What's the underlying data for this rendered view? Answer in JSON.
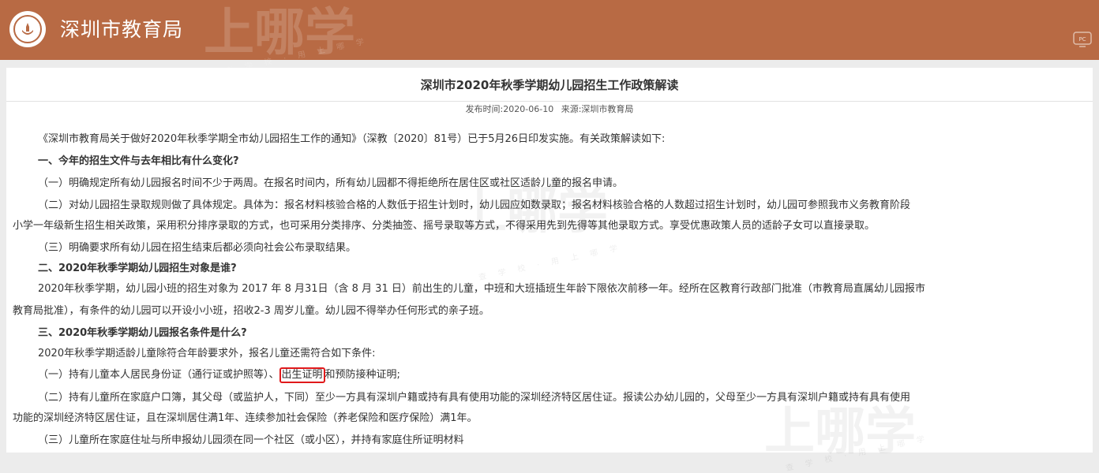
{
  "header": {
    "site_name": "深圳市教育局",
    "watermark_text": "上哪学",
    "watermark_sub": "查 学 校 · 用 上 哪 学",
    "pc_icon_label": "PC",
    "bg_color": "#b86a44"
  },
  "article": {
    "title": "深圳市2020年秋季学期幼儿园招生工作政策解读",
    "publish_time": "发布时间:2020-06-10",
    "source": "来源:深圳市教育局",
    "paragraphs": [
      "《深圳市教育局关于做好2020年秋季学期全市幼儿园招生工作的通知》（深教〔2020〕81号）已于5月26日印发实施。有关政策解读如下:",
      "一、今年的招生文件与去年相比有什么变化?",
      "（一）明确规定所有幼儿园报名时间不少于两周。在报名时间内，所有幼儿园都不得拒绝所在居住区或社区适龄儿童的报名申请。",
      "（二）对幼儿园招生录取规则做了具体规定。具体为：报名材料核验合格的人数低于招生计划时，幼儿园应如数录取；报名材料核验合格的人数超过招生计划时，幼儿园可参照我市义务教育阶段",
      "小学一年级新生招生相关政策，采用积分排序录取的方式，也可采用分类排序、分类抽签、摇号录取等方式，不得采用先到先得等其他录取方式。享受优惠政策人员的适龄子女可以直接录取。",
      "（三）明确要求所有幼儿园在招生结束后都必须向社会公布录取结果。",
      "二、2020年秋季学期幼儿园招生对象是谁?",
      "2020年秋季学期，幼儿园小班的招生对象为 2017 年 8 月31日（含 8 月 31 日）前出生的儿童，中班和大班插班生年龄下限依次前移一年。经所在区教育行政部门批准（市教育局直属幼儿园报市",
      "教育局批准），有条件的幼儿园可以开设小小班，招收2-3 周岁儿童。幼儿园不得举办任何形式的亲子班。",
      "三、2020年秋季学期幼儿园报名条件是什么?",
      "2020年秋季学期适龄儿童除符合年龄要求外，报名儿童还需符合如下条件:",
      "（二）持有儿童所在家庭户口簿，其父母（或监护人，下同）至少一方具有深圳户籍或持有具有使用功能的深圳经济特区居住证。报读公办幼儿园的，父母至少一方具有深圳户籍或持有具有使用",
      "功能的深圳经济特区居住证，且在深圳居住满1年、连续参加社会保险（养老保险和医疗保险）满1年。",
      "（三）儿童所在家庭住址与所申报幼儿园须在同一个社区（或小区），并持有家庭住所证明材料"
    ],
    "condition_one": {
      "before": "（一）持有儿童本人居民身份证（通行证或护照等）、",
      "highlight": "出生证明",
      "after": "和预防接种证明;"
    },
    "highlight_color": "#e0191b"
  }
}
